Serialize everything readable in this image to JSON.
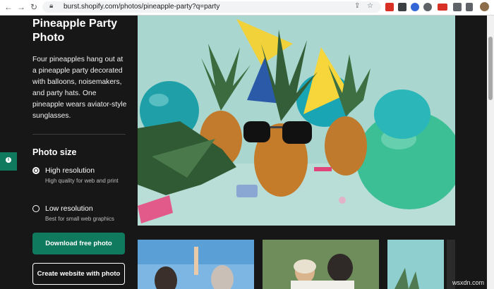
{
  "browser": {
    "url": "burst.shopify.com/photos/pineapple-party?q=party",
    "back_icon": "arrow-left-icon",
    "forward_icon": "arrow-right-icon",
    "reload_icon": "reload-icon",
    "extensions": [
      "text-extension-icon",
      "tags-extension-icon",
      "settings-extension-icon",
      "record-extension-icon",
      "puzzle-icon",
      "list-icon",
      "profile-avatar"
    ],
    "colors": {
      "ext_red": "#d93025",
      "ext_dark": "#3c4043",
      "ext_blue": "#3367d6"
    }
  },
  "sidebar": {
    "title": "Pineapple Party Photo",
    "description": "Four pineapples hang out at a pineapple party decorated with balloons, noisemakers, and party hats. One pineapple wears aviator-style sunglasses.",
    "photo_size_heading": "Photo size",
    "options": [
      {
        "label": "High resolution",
        "description": "High quality for web and print",
        "selected": true
      },
      {
        "label": "Low resolution",
        "description": "Best for small web graphics",
        "selected": false
      }
    ],
    "download_label": "Download free photo",
    "create_label": "Create website with photo"
  },
  "watermark": "wsxdn.com",
  "colors": {
    "accent": "#0f7a5e",
    "page_bg": "#171717"
  }
}
